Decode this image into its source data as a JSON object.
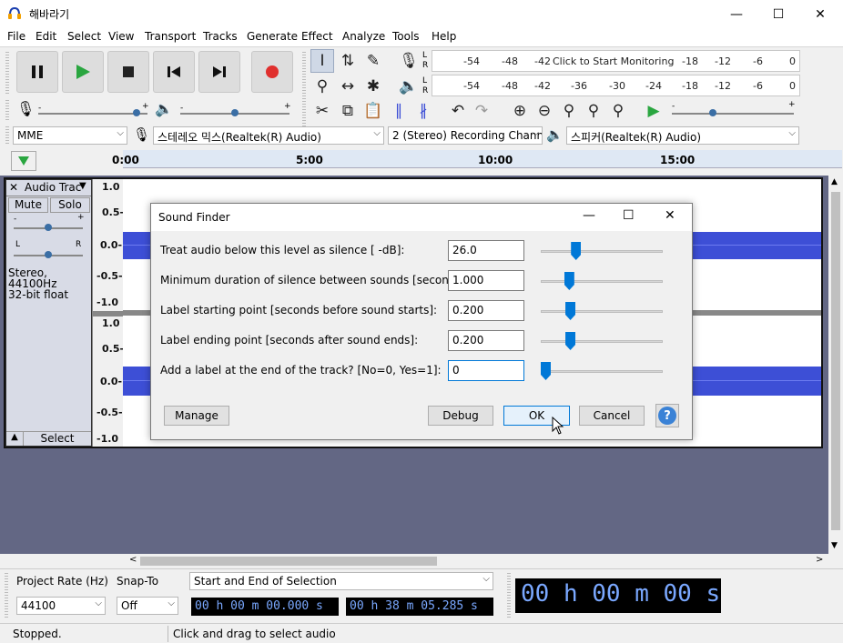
{
  "window": {
    "title": "해바라기"
  },
  "menu": [
    "File",
    "Edit",
    "Select",
    "View",
    "Transport",
    "Tracks",
    "Generate",
    "Effect",
    "Analyze",
    "Tools",
    "Help"
  ],
  "meters": {
    "record_ticks": [
      "-54",
      "-48",
      "-42",
      "-18",
      "-12",
      "-6",
      "0"
    ],
    "record_prompt": "Click to Start Monitoring",
    "play_ticks": [
      "-54",
      "-48",
      "-42",
      "-36",
      "-30",
      "-24",
      "-18",
      "-12",
      "-6",
      "0"
    ],
    "lr": [
      "L",
      "R"
    ]
  },
  "devices": {
    "host": "MME",
    "input": "스테레오 믹스(Realtek(R) Audio)",
    "channels": "2 (Stereo) Recording Chann",
    "output": "스피커(Realtek(R) Audio)"
  },
  "ruler": [
    "0:00",
    "5:00",
    "10:00",
    "15:00"
  ],
  "track": {
    "name": "Audio Trac",
    "mute": "Mute",
    "solo": "Solo",
    "info1": "Stereo, 44100Hz",
    "info2": "32-bit float",
    "select": "Select",
    "gain_minus": "-",
    "gain_plus": "+",
    "pan_l": "L",
    "pan_r": "R",
    "y_labels": [
      "1.0",
      "0.5-",
      "0.0-",
      "-0.5-",
      "-1.0"
    ]
  },
  "dialog": {
    "title": "Sound Finder",
    "fields": [
      {
        "label": "Treat audio below this level as silence [ -dB]:",
        "value": "26.0",
        "slider": 0.27
      },
      {
        "label": "Minimum duration of silence between sounds [seconds]:",
        "value": "1.000",
        "slider": 0.21
      },
      {
        "label": "Label starting point [seconds before sound starts]:",
        "value": "0.200",
        "slider": 0.22
      },
      {
        "label": "Label ending point [seconds after sound ends]:",
        "value": "0.200",
        "slider": 0.22
      },
      {
        "label": "Add a label at the end of the track? [No=0, Yes=1]:",
        "value": "0",
        "slider": 0.0
      }
    ],
    "buttons": {
      "manage": "Manage",
      "debug": "Debug",
      "ok": "OK",
      "cancel": "Cancel",
      "help": "?"
    }
  },
  "bottom": {
    "project_rate_label": "Project Rate (Hz)",
    "snap_label": "Snap-To",
    "selection_mode": "Start and End of Selection",
    "rate": "44100",
    "snap": "Off",
    "sel_start": "00 h 00 m 00.000 s",
    "sel_end": "00 h 38 m 05.285 s",
    "audio_pos": "00 h 00 m 00 s"
  },
  "status": {
    "state": "Stopped.",
    "hint": "Click and drag to select audio"
  },
  "colors": {
    "wave": "#3d4fd6",
    "track_bg": "#636784",
    "accent": "#0078d7",
    "record": "#e0302e",
    "play": "#2aa640"
  }
}
